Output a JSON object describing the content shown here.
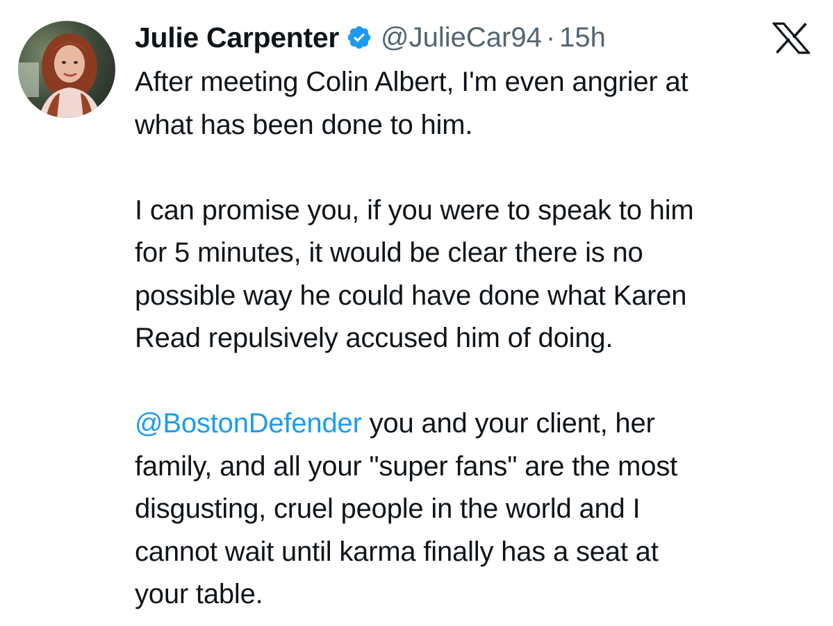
{
  "tweet": {
    "author": {
      "display_name": "Julie Carpenter",
      "handle": "@JulieCar94",
      "verified_icon": "verified-badge-icon",
      "verified_color": "#1d9bf0"
    },
    "separator": "·",
    "timestamp": "15h",
    "platform_icon": "x-logo-icon",
    "paragraphs": [
      [
        "After meeting Colin Albert, I'm even angrier at",
        "what has been done to him."
      ],
      [
        "I can promise you, if you were to speak to him",
        "for 5 minutes, it would be clear there is no",
        "possible way he could have done what Karen",
        "Read repulsively accused him of doing."
      ],
      [
        "you and your client, her",
        "family, and all your \"super fans\" are the most",
        "disgusting, cruel people in the world and I",
        "cannot wait until karma finally has a seat at",
        "your table."
      ]
    ],
    "mention": "@BostonDefender",
    "mention_color": "#1d9bf0"
  }
}
